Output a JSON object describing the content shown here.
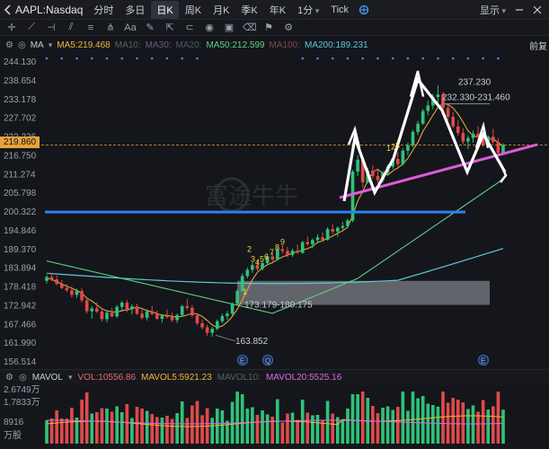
{
  "header": {
    "symbol": "AAPL:Nasdaq",
    "timeframes": [
      {
        "label": "分时",
        "active": false,
        "dropdown": false
      },
      {
        "label": "多日",
        "active": false,
        "dropdown": false
      },
      {
        "label": "日K",
        "active": true,
        "dropdown": false
      },
      {
        "label": "周K",
        "active": false,
        "dropdown": false
      },
      {
        "label": "月K",
        "active": false,
        "dropdown": false
      },
      {
        "label": "季K",
        "active": false,
        "dropdown": false
      },
      {
        "label": "年K",
        "active": false,
        "dropdown": false
      },
      {
        "label": "1分",
        "active": false,
        "dropdown": true
      },
      {
        "label": "Tick",
        "active": false,
        "dropdown": false
      }
    ],
    "display_label": "显示",
    "front_label": "前复"
  },
  "ma": {
    "label": "MA",
    "ma5": "MA5:219.468",
    "ma10": "MA10:",
    "ma30": "MA30:",
    "ma20": "MA20:",
    "ma50": "MA50:212.599",
    "ma100": "MA100:",
    "ma200": "MA200:189.231"
  },
  "current_price": "219.860",
  "watermark": "富途牛牛",
  "chart_data": {
    "type": "candlestick",
    "price_axis_ticks": [
      "244.130",
      "238.654",
      "233.178",
      "227.702",
      "222.226",
      "216.750",
      "211.274",
      "205.798",
      "200.322",
      "194.846",
      "189.370",
      "183.894",
      "178.418",
      "172.942",
      "167.466",
      "161.990",
      "156.514"
    ],
    "ylim": [
      156.514,
      244.13
    ],
    "annotations": {
      "high": "237.230",
      "resistance_range": "232.330-231.460",
      "support_range": "173.179-180.175",
      "low": "163.852",
      "wave_labels": [
        "1",
        "2",
        "3",
        "4",
        "5",
        "6",
        "7",
        "8",
        "9"
      ],
      "wave_labels_right": [
        "1",
        "2",
        "3"
      ]
    },
    "horizontal_line_price": 200.3,
    "highlight_zone": [
      173.179,
      180.175
    ],
    "ohlc": [
      [
        180.2,
        181.9,
        179.4,
        181.3
      ],
      [
        181.3,
        182.6,
        180.1,
        180.6
      ],
      [
        180.6,
        181.8,
        178.9,
        179.3
      ],
      [
        179.3,
        180.4,
        177.8,
        178.1
      ],
      [
        178.1,
        179.2,
        176.9,
        177.4
      ],
      [
        177.4,
        178.6,
        175.3,
        176.1
      ],
      [
        176.1,
        177.9,
        175.2,
        177.2
      ],
      [
        177.2,
        178.1,
        173.8,
        174.5
      ],
      [
        174.5,
        175.2,
        170.6,
        171.3
      ],
      [
        171.3,
        172.8,
        169.1,
        172.1
      ],
      [
        172.1,
        173.9,
        170.8,
        171.2
      ],
      [
        171.2,
        172.4,
        168.3,
        169.0
      ],
      [
        169.0,
        171.6,
        168.1,
        170.9
      ],
      [
        170.9,
        172.3,
        169.5,
        169.8
      ],
      [
        169.8,
        173.1,
        169.4,
        172.6
      ],
      [
        172.6,
        174.4,
        171.2,
        173.8
      ],
      [
        173.8,
        174.6,
        171.1,
        171.9
      ],
      [
        171.9,
        173.3,
        170.4,
        172.7
      ],
      [
        172.7,
        173.5,
        170.2,
        170.6
      ],
      [
        170.6,
        171.9,
        168.9,
        169.4
      ],
      [
        169.4,
        171.8,
        168.6,
        171.3
      ],
      [
        171.3,
        172.9,
        170.1,
        170.5
      ],
      [
        170.5,
        171.6,
        168.7,
        169.1
      ],
      [
        169.1,
        170.4,
        167.9,
        170.0
      ],
      [
        170.0,
        171.8,
        169.2,
        169.6
      ],
      [
        169.6,
        170.9,
        168.1,
        168.7
      ],
      [
        168.7,
        170.6,
        167.9,
        170.2
      ],
      [
        170.2,
        173.2,
        169.8,
        172.8
      ],
      [
        172.8,
        174.9,
        171.7,
        172.3
      ],
      [
        172.3,
        173.1,
        169.6,
        170.1
      ],
      [
        170.1,
        170.8,
        167.2,
        167.8
      ],
      [
        167.8,
        168.9,
        166.0,
        166.6
      ],
      [
        166.6,
        167.4,
        164.1,
        165.0
      ],
      [
        165.0,
        166.8,
        163.852,
        166.2
      ],
      [
        166.2,
        168.9,
        165.7,
        168.4
      ],
      [
        168.4,
        170.6,
        167.9,
        169.9
      ],
      [
        169.9,
        171.4,
        168.8,
        170.6
      ],
      [
        170.6,
        173.9,
        170.1,
        173.5
      ],
      [
        173.5,
        177.8,
        173.1,
        177.2
      ],
      [
        177.2,
        182.4,
        176.9,
        181.6
      ],
      [
        181.6,
        184.1,
        180.9,
        183.4
      ],
      [
        183.4,
        185.6,
        182.5,
        184.8
      ],
      [
        184.8,
        186.2,
        183.1,
        183.7
      ],
      [
        183.7,
        185.9,
        183.2,
        185.4
      ],
      [
        185.4,
        187.9,
        184.9,
        187.3
      ],
      [
        187.3,
        188.6,
        185.8,
        186.5
      ],
      [
        186.5,
        189.9,
        186.1,
        189.4
      ],
      [
        189.4,
        190.6,
        188.2,
        188.9
      ],
      [
        188.9,
        190.1,
        187.1,
        187.8
      ],
      [
        187.8,
        189.5,
        187.2,
        189.0
      ],
      [
        189.0,
        190.8,
        188.1,
        188.4
      ],
      [
        188.4,
        191.9,
        188.0,
        191.5
      ],
      [
        191.5,
        193.1,
        190.4,
        190.9
      ],
      [
        190.9,
        192.6,
        189.7,
        192.1
      ],
      [
        192.1,
        193.8,
        191.2,
        192.9
      ],
      [
        192.9,
        194.4,
        191.6,
        192.2
      ],
      [
        192.2,
        195.9,
        191.9,
        195.3
      ],
      [
        195.3,
        196.7,
        193.9,
        194.6
      ],
      [
        194.6,
        196.1,
        193.1,
        195.7
      ],
      [
        195.7,
        197.4,
        195.1,
        196.2
      ],
      [
        196.2,
        198.4,
        195.6,
        197.8
      ],
      [
        197.8,
        212.6,
        197.3,
        212.1
      ],
      [
        212.1,
        216.9,
        210.8,
        215.6
      ],
      [
        215.6,
        216.5,
        207.4,
        209.0
      ],
      [
        209.0,
        213.2,
        208.6,
        212.4
      ],
      [
        212.4,
        213.9,
        210.1,
        210.8
      ],
      [
        210.8,
        212.7,
        208.7,
        209.6
      ],
      [
        209.6,
        212.3,
        208.9,
        211.8
      ],
      [
        211.8,
        214.2,
        210.9,
        213.6
      ],
      [
        213.6,
        216.4,
        212.9,
        215.8
      ],
      [
        215.8,
        217.7,
        213.6,
        214.3
      ],
      [
        214.3,
        218.9,
        213.9,
        218.2
      ],
      [
        218.2,
        220.6,
        216.9,
        219.8
      ],
      [
        219.8,
        224.3,
        219.2,
        223.7
      ],
      [
        223.7,
        226.9,
        222.8,
        226.1
      ],
      [
        226.1,
        230.4,
        225.7,
        229.8
      ],
      [
        229.8,
        232.9,
        228.6,
        231.4
      ],
      [
        231.4,
        234.8,
        230.3,
        233.9
      ],
      [
        233.9,
        237.23,
        232.1,
        234.6
      ],
      [
        234.6,
        235.4,
        229.8,
        230.7
      ],
      [
        230.7,
        231.9,
        227.2,
        228.1
      ],
      [
        228.1,
        229.6,
        224.8,
        225.3
      ],
      [
        225.3,
        227.1,
        222.6,
        223.4
      ],
      [
        223.4,
        224.8,
        220.1,
        220.9
      ],
      [
        220.9,
        222.6,
        218.7,
        221.9
      ],
      [
        221.9,
        224.1,
        220.5,
        223.2
      ],
      [
        223.2,
        225.4,
        221.6,
        222.1
      ],
      [
        222.1,
        223.8,
        219.3,
        219.9
      ],
      [
        219.9,
        222.7,
        219.1,
        222.3
      ],
      [
        222.3,
        224.6,
        220.2,
        220.8
      ],
      [
        220.8,
        221.9,
        216.7,
        217.6
      ],
      [
        217.6,
        220.4,
        216.9,
        219.86
      ]
    ],
    "ma_series_visible": [
      "MA5",
      "MA50",
      "MA200"
    ],
    "ma5": [
      181,
      180.6,
      179.9,
      179.3,
      178.6,
      178.0,
      177.4,
      176.6,
      175.1,
      174.3,
      173.2,
      172.0,
      171.4,
      171.2,
      171.0,
      171.5,
      171.7,
      172.1,
      172.5,
      172.1,
      171.5,
      171.2,
      170.6,
      170.2,
      170.1,
      169.8,
      169.6,
      169.8,
      170.2,
      170.7,
      170.5,
      169.8,
      168.6,
      167.3,
      166.6,
      167.0,
      168.2,
      169.8,
      171.9,
      174.6,
      177.6,
      180.5,
      182.7,
      184.0,
      184.9,
      185.5,
      186.4,
      187.2,
      187.7,
      188.3,
      188.7,
      189.2,
      189.6,
      190.3,
      191.4,
      191.9,
      192.6,
      193.3,
      194.1,
      194.8,
      195.9,
      199.2,
      203.5,
      206.3,
      209.5,
      212.0,
      212.8,
      211.5,
      211.1,
      212.3,
      213.2,
      214.3,
      216.0,
      218.4,
      220.6,
      223.9,
      226.2,
      228.6,
      230.9,
      232.0,
      231.7,
      230.7,
      228.9,
      226.6,
      224.0,
      222.6,
      222.2,
      221.9,
      221.6,
      221.7,
      220.6,
      219.5
    ]
  },
  "volume": {
    "label": "MAVOL",
    "vol": "VOL:10556.86",
    "mavol5": "MAVOL5:5921.23",
    "mavol10": "MAVOL10:",
    "mavol20": "MAVOL20:5525.16",
    "axis_ticks": [
      "2.6749万",
      "1.7833万",
      "8916",
      "万股"
    ]
  }
}
